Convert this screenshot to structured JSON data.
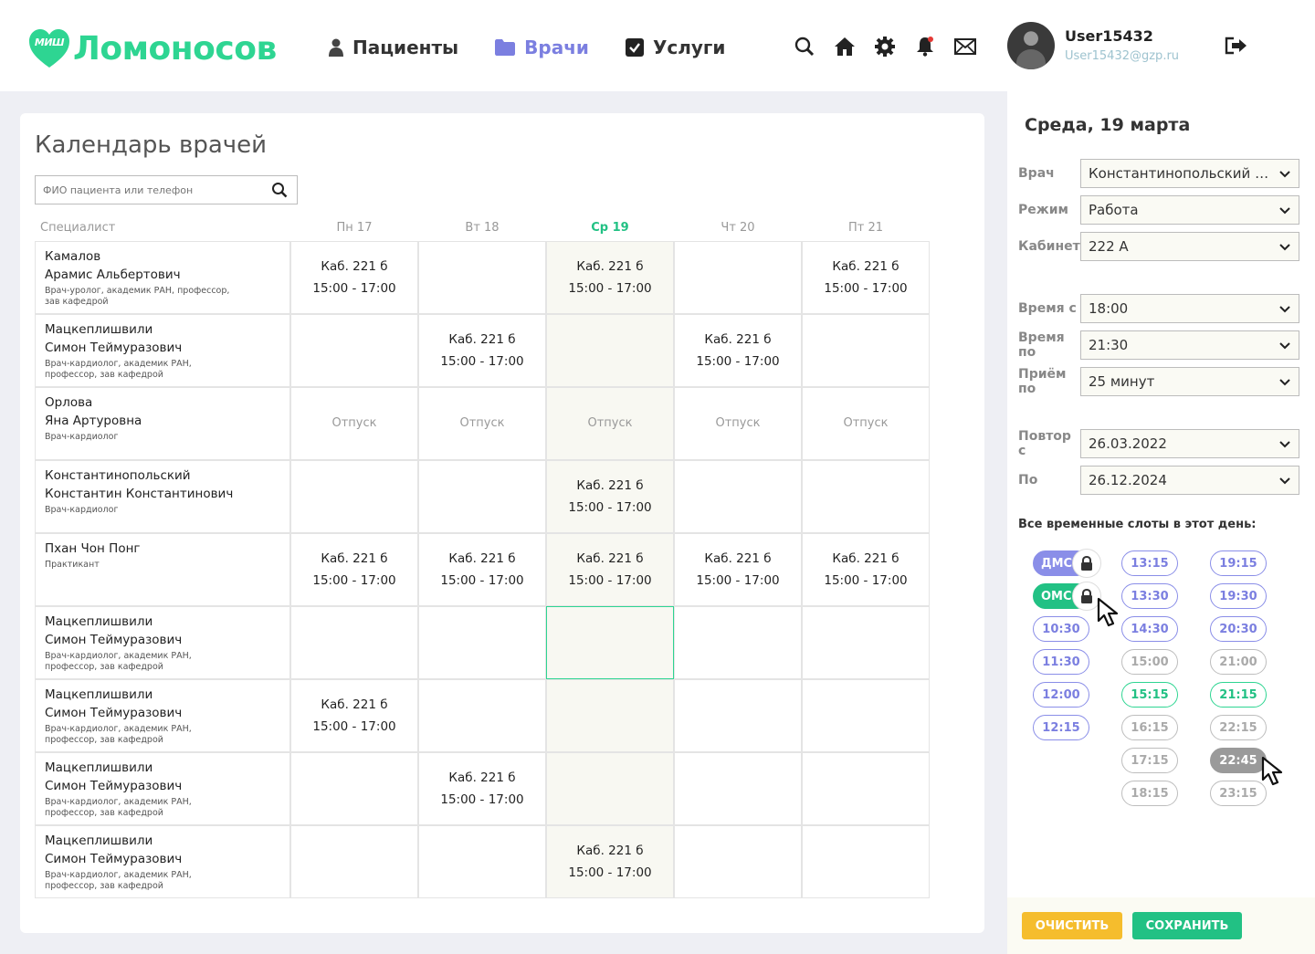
{
  "logo": {
    "mini": "МИШ",
    "text": "Ломоносов"
  },
  "nav": [
    {
      "label": "Пациенты",
      "icon": "user-icon"
    },
    {
      "label": "Врачи",
      "icon": "folder-icon"
    },
    {
      "label": "Услуги",
      "icon": "checkbox-icon"
    }
  ],
  "header_icons": [
    "search-icon",
    "home-icon",
    "gear-icon",
    "bell-icon",
    "mail-icon"
  ],
  "user": {
    "name": "User15432",
    "email": "User15432@gzp.ru"
  },
  "page_title": "Календарь врачей",
  "search": {
    "placeholder": "ФИО пациента или телефон"
  },
  "columns": {
    "spec": "Специалист",
    "days": [
      "Пн 17",
      "Вт 18",
      "Ср 19",
      "Чт 20",
      "Пт 21"
    ]
  },
  "rows": [
    {
      "name": "Камалов\nАрамис Альбертович",
      "role": "Врач-уролог, академик РАН, профессор,\nзав кафедрой",
      "cells": [
        "slot",
        "",
        "slot",
        "",
        "slot"
      ]
    },
    {
      "name": "Мацкеплишвили\nСимон Теймуразович",
      "role": "Врач-кардиолог, академик РАН,\nпрофессор, зав кафедрой",
      "cells": [
        "",
        "slot",
        "",
        "slot",
        ""
      ]
    },
    {
      "name": "Орлова\nЯна Артуровна",
      "role": "Врач-кардиолог",
      "cells": [
        "vac",
        "vac",
        "vac",
        "vac",
        "vac"
      ]
    },
    {
      "name": "Константинопольский\nКонстантин Константинович",
      "role": "Врач-кардиолог",
      "cells": [
        "",
        "",
        "slot",
        "",
        ""
      ]
    },
    {
      "name": "Пхан Чон Понг",
      "role": "Практикант",
      "cells": [
        "slot",
        "slot",
        "slot",
        "slot",
        "slot"
      ]
    },
    {
      "name": "Мацкеплишвили\nСимон Теймуразович",
      "role": "Врач-кардиолог, академик РАН,\nпрофессор, зав кафедрой",
      "cells": [
        "",
        "",
        "",
        "",
        ""
      ]
    },
    {
      "name": "Мацкеплишвили\nСимон Теймуразович",
      "role": "Врач-кардиолог, академик РАН,\nпрофессор, зав кафедрой",
      "cells": [
        "slot",
        "",
        "",
        "",
        ""
      ]
    },
    {
      "name": "Мацкеплишвили\nСимон Теймуразович",
      "role": "Врач-кардиолог, академик РАН,\nпрофессор, зав кафедрой",
      "cells": [
        "",
        "slot",
        "",
        "",
        ""
      ]
    },
    {
      "name": "Мацкеплишвили\nСимон Теймуразович",
      "role": "Врач-кардиолог, академик РАН,\nпрофессор, зав кафедрой",
      "cells": [
        "",
        "",
        "slot",
        "",
        ""
      ]
    }
  ],
  "slot_text": {
    "room": "Каб. 221 б",
    "time": "15:00 - 17:00"
  },
  "vacation_text": "Отпуск",
  "panel": {
    "date": "Среда, 19 марта",
    "fields": [
      {
        "label": "Врач",
        "value": "Константинопольский Константин"
      },
      {
        "label": "Режим",
        "value": "Работа"
      },
      {
        "label": "Кабинет",
        "value": "222 А"
      },
      {
        "label": "Время с",
        "value": "18:00"
      },
      {
        "label": "Время по",
        "value": "21:30"
      },
      {
        "label": "Приём по",
        "value": "25 минут"
      },
      {
        "label": "Повтор с",
        "value": "26.03.2022"
      },
      {
        "label": "По",
        "value": "26.12.2024"
      }
    ],
    "slots_title": "Все временные слоты в этот день:",
    "slots": [
      [
        {
          "t": "ДМС",
          "s": "tag-purple",
          "lock": true
        },
        {
          "t": "ОМС",
          "s": "tag-green",
          "lock": true
        },
        {
          "t": "10:30",
          "s": "purple"
        },
        {
          "t": "11:30",
          "s": "purple"
        },
        {
          "t": "12:00",
          "s": "purple"
        },
        {
          "t": "12:15",
          "s": "purple"
        }
      ],
      [
        {
          "t": "13:15",
          "s": "purple"
        },
        {
          "t": "13:30",
          "s": "purple"
        },
        {
          "t": "14:30",
          "s": "purple"
        },
        {
          "t": "15:00",
          "s": "gray"
        },
        {
          "t": "15:15",
          "s": "green"
        },
        {
          "t": "16:15",
          "s": "gray"
        },
        {
          "t": "17:15",
          "s": "gray"
        },
        {
          "t": "18:15",
          "s": "gray"
        }
      ],
      [
        {
          "t": "19:15",
          "s": "purple"
        },
        {
          "t": "19:30",
          "s": "purple"
        },
        {
          "t": "20:30",
          "s": "purple"
        },
        {
          "t": "21:00",
          "s": "gray"
        },
        {
          "t": "21:15",
          "s": "green"
        },
        {
          "t": "22:15",
          "s": "gray"
        },
        {
          "t": "22:45",
          "s": "dark"
        },
        {
          "t": "23:15",
          "s": "gray"
        }
      ]
    ],
    "buttons": {
      "clear": "ОЧИСТИТЬ",
      "save": "СОХРАНИТЬ"
    }
  },
  "colors": {
    "accent_green": "#22c184",
    "accent_purple": "#7b7fe0",
    "warning": "#f5bd2d"
  }
}
